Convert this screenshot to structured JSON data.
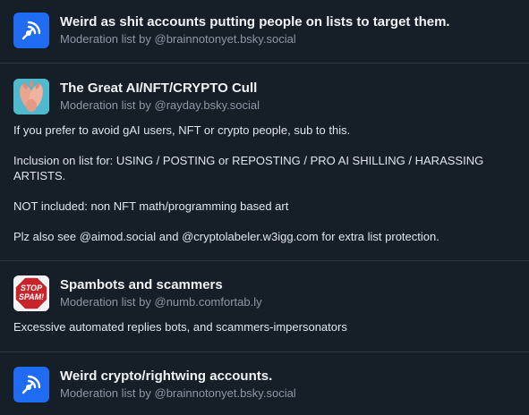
{
  "lists": [
    {
      "avatar": "default-list-icon",
      "name": "Weird as shit accounts putting people on lists to target them.",
      "byline": "Moderation list by @brainnotonyet.bsky.social",
      "description": []
    },
    {
      "avatar": "hands-icon",
      "name": "The Great AI/NFT/CRYPTO Cull",
      "byline": "Moderation list by @rayday.bsky.social",
      "description": [
        "If you prefer to avoid gAI users, NFT or crypto people, sub to this.",
        "Inclusion on list for: USING / POSTING or REPOSTING / PRO AI SHILLING /  HARASSING ARTISTS.",
        "NOT included: non NFT math/programming based art",
        "Plz also see @aimod.social and @cryptolabeler.w3igg.com for extra list protection."
      ]
    },
    {
      "avatar": "stop-spam-icon",
      "avatar_text": "STOP SPAM!",
      "name": "Spambots and scammers",
      "byline": "Moderation list by @numb.comfortab.ly",
      "description": [
        "Excessive automated replies bots, and scammers-impersonators"
      ]
    },
    {
      "avatar": "default-list-icon",
      "name": "Weird crypto/rightwing accounts.",
      "byline": "Moderation list by @brainnotonyet.bsky.social",
      "description": []
    }
  ],
  "colors": {
    "background": "#161e27",
    "divider": "#2b3642",
    "default_avatar": "#1f6bf2",
    "byline": "#8b98a8"
  }
}
